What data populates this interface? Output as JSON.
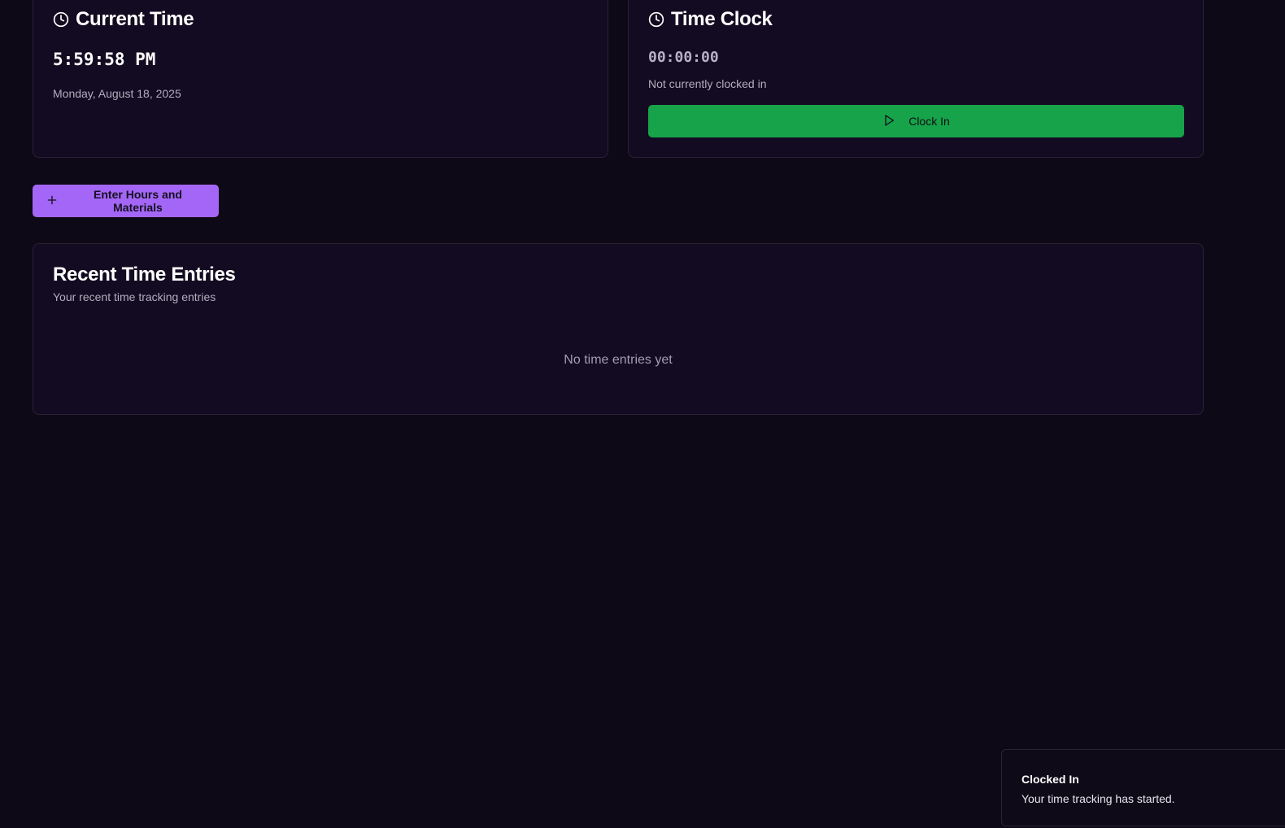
{
  "current_time_card": {
    "title": "Current Time",
    "time": "5:59:58 PM",
    "date": "Monday, August 18, 2025",
    "icon": "clock-icon"
  },
  "time_clock_card": {
    "title": "Time Clock",
    "timer": "00:00:00",
    "status": "Not currently clocked in",
    "button_label": "Clock In",
    "button_icon": "play-icon",
    "button_color": "#16a34a",
    "icon": "clock-icon"
  },
  "actions": {
    "enter_hours_label": "Enter Hours and Materials",
    "enter_hours_icon": "plus-icon",
    "enter_hours_color": "#a366f7"
  },
  "recent_entries": {
    "title": "Recent Time Entries",
    "subtitle": "Your recent time tracking entries",
    "empty_message": "No time entries yet"
  },
  "toast": {
    "title": "Clocked In",
    "description": "Your time tracking has started."
  }
}
